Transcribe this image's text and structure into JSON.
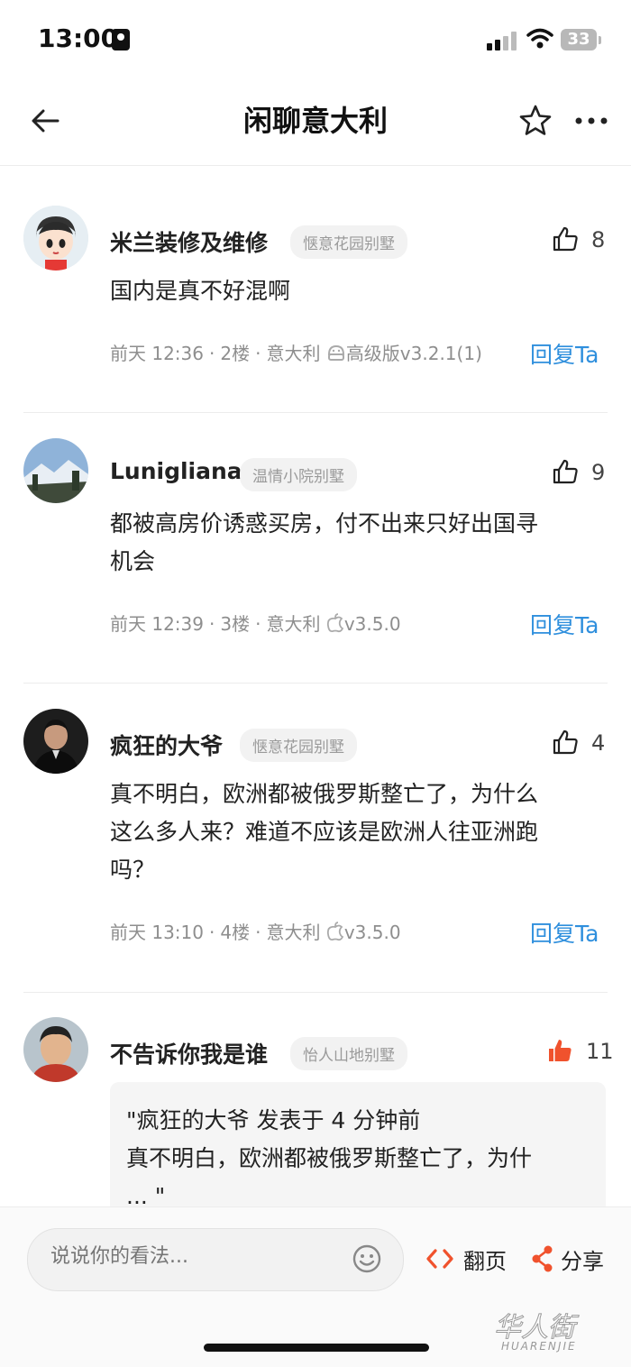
{
  "status_bar": {
    "time": "13:00",
    "battery": "33"
  },
  "nav": {
    "title": "闲聊意大利",
    "back_icon": "arrow-left-icon",
    "star_icon": "star-outline-icon",
    "more_icon": "more-dots-icon"
  },
  "comments": [
    {
      "username": "米兰装修及维修",
      "badge": "惬意花园别墅",
      "likes": "8",
      "content": "国内是真不好混啊",
      "time": "前天 12:36",
      "floor": "2楼",
      "location": "意大利",
      "client": "高级版v3.2.1(1)",
      "client_icon": "android-icon",
      "reply": "回复Ta"
    },
    {
      "username": "Luniglian​a",
      "badge": "温情小院别墅",
      "likes": "9",
      "content_lines": [
        "都被高房价诱惑买房，付不出来只好出国寻",
        "机会"
      ],
      "time": "前天 12:39",
      "floor": "3楼",
      "location": "意大利",
      "client": "v3.5.0",
      "client_icon": "apple-icon",
      "reply": "回复Ta"
    },
    {
      "username": "疯狂的大爷",
      "badge": "惬意花园别墅",
      "likes": "4",
      "content_lines": [
        "真不明白，欧洲都被俄罗斯整亡了，为什么",
        "这么多人来？难道不应该是欧洲人往亚洲跑",
        "吗？"
      ],
      "time": "前天 13:10",
      "floor": "4楼",
      "location": "意大利",
      "client": "v3.5.0",
      "client_icon": "apple-icon",
      "reply": "回复Ta"
    },
    {
      "username": "不告诉你我是谁",
      "badge": "怡人山地别墅",
      "likes": "11",
      "quote_lines": [
        "\"疯狂的大爷 发表于 4 分钟前",
        "真不明白，欧洲都被俄罗斯整亡了，为什",
        "... \""
      ]
    }
  ],
  "bottom_bar": {
    "input_placeholder": "说说你的看法...",
    "flip_label": "翻页",
    "share_label": "分享"
  },
  "watermark": {
    "text": "华人街",
    "subtext": "HUARENJIE"
  },
  "colors": {
    "link_blue": "#2f8fdd",
    "like_active": "#f0522d",
    "badge_bg": "#f2f2f2"
  }
}
